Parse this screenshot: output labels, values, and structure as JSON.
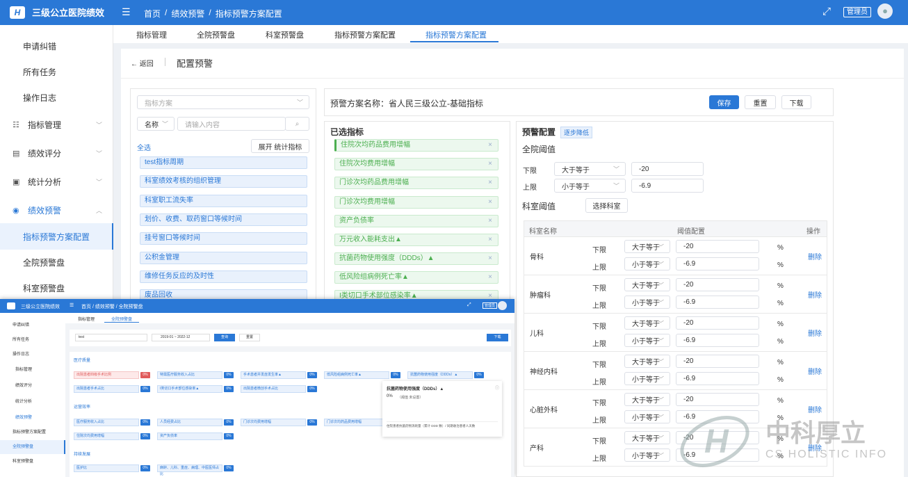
{
  "app": {
    "title": "三级公立医院绩效",
    "breadcrumb": [
      "首页",
      "绩效预警",
      "指标预警方案配置"
    ],
    "role": "管理员"
  },
  "sidebar": {
    "items": [
      {
        "label": "申请纠错"
      },
      {
        "label": "所有任务"
      },
      {
        "label": "操作日志"
      },
      {
        "label": "指标管理",
        "icon": "list-icon"
      },
      {
        "label": "绩效评分",
        "icon": "bag-icon"
      },
      {
        "label": "统计分析",
        "icon": "chart-icon"
      },
      {
        "label": "绩效预警",
        "icon": "eye-icon"
      },
      {
        "label": "指标预警方案配置"
      },
      {
        "label": "全院预警盘"
      },
      {
        "label": "科室预警盘"
      }
    ]
  },
  "tabs": [
    "指标管理",
    "全院预警盘",
    "科室预警盘",
    "指标预警方案配置",
    "指标预警方案配置"
  ],
  "page": {
    "back": "返回",
    "title": "配置预警"
  },
  "left": {
    "scheme_placeholder": "指标方案",
    "name_select": "名称",
    "search_placeholder": "请输入内容",
    "select_all": "全选",
    "expand_btn": "展开 统计指标",
    "indicators": [
      "test指标周期",
      "科室绩效考核的组织管理",
      "科室职工流失率",
      "划价、收费、取药窗口等候时间",
      "挂号窗口等候时间",
      "公积金管理",
      "维修任务反应的及时性",
      "废品回收"
    ]
  },
  "scheme": {
    "name_label": "预警方案名称：省人民三级公立-基础指标",
    "save": "保存",
    "reset": "重置",
    "download": "下载"
  },
  "selected": {
    "title": "已选指标",
    "items": [
      "住院次均药品费用增幅",
      "住院次均费用增幅",
      "门诊次均药品费用增幅",
      "门诊次均费用增幅",
      "资产负债率",
      "万元收入能耗支出▲",
      "抗菌药物使用强度（DDDs）▲",
      "低风险组病例死亡率▲",
      "I类切口手术部位感染率▲"
    ]
  },
  "config": {
    "title": "预警配置",
    "tag": "逐步降低",
    "hospital_title": "全院阈值",
    "lower_label": "下限",
    "upper_label": "上限",
    "lower_op": "大于等于",
    "upper_op": "小于等于",
    "lower_val": "-20",
    "upper_val": "-6.9",
    "dept_title": "科室阈值",
    "choose_dept": "选择科室",
    "table_headers": [
      "科室名称",
      "阈值配置",
      "操作"
    ],
    "op_short_lower": "大于等于",
    "op_short_upper": "小于等于",
    "pct": "%",
    "delete": "删除",
    "depts": [
      "骨科",
      "肿瘤科",
      "儿科",
      "神经内科",
      "心脏外科",
      "产科"
    ],
    "dept_lower": "-20",
    "dept_upper": "-6.9"
  },
  "overlay": {
    "title": "三级公立医院绩效",
    "breadcrumb": "首页 / 绩效预警 / 全院预警盘",
    "tabs": [
      "指标管理",
      "全院预警盘"
    ],
    "filter": "test",
    "date_from": "2019-01",
    "date_to": "2022-12",
    "query": "查询",
    "reset": "重置",
    "download": "下载",
    "admin": "管理员",
    "sidebar": [
      "申请纠错",
      "所有任务",
      "操作日志",
      "指标管理",
      "绩效评分",
      "统计分析",
      "绩效预警",
      "指标预警方案配置",
      "全院预警盘",
      "科室预警盘"
    ],
    "sections": [
      "医疗质量",
      "运营效率",
      "持续发展"
    ],
    "quality_row1": [
      "出院患者四级手术比例",
      "特需医疗服务收入占比",
      "手术患者并发症发生率▲",
      "低风险组病例死亡率▲",
      "抗菌药物使用强度（DDDs）▲"
    ],
    "quality_row2": [
      "出院患者手术占比",
      "I类切口手术部位感染率▲",
      "出院患者微创手术占比"
    ],
    "ops_row1": [
      "医疗服务收入占比",
      "人员经费占比",
      "门诊次均费用增幅",
      "门诊次均药品费用增幅"
    ],
    "ops_row2": [
      "住院次均费用增幅",
      "资产负债率"
    ],
    "dev_row1": [
      "医护比",
      "麻醉、儿科、重症、病理、中医医师占比"
    ],
    "zero": "0%",
    "tooltip_title": "抗菌药物使用强度（DDDs）▲",
    "tooltip_value": "0%",
    "tooltip_note": "（阈值 未设置）",
    "tooltip_formula": "住院患者抗菌药物消耗量（累计 DDD 数）/ 同期收治患者人天数"
  },
  "watermark": {
    "cn": "中科厚立",
    "en": "CS HOLISTIC INFO"
  },
  "colors": {
    "primary": "#2a78d6",
    "selected_green": "#4caf50"
  }
}
